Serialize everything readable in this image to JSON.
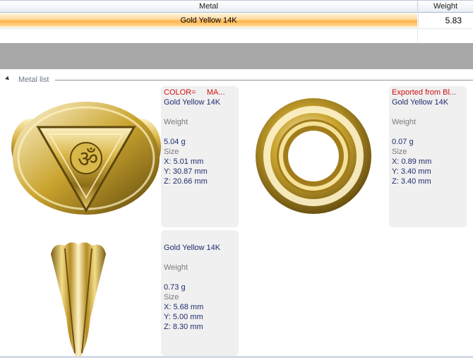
{
  "table": {
    "headers": {
      "metal": "Metal",
      "weight": "Weight"
    },
    "rows": [
      {
        "metal": "Gold Yellow 14K",
        "weight": "5.83"
      }
    ]
  },
  "group": {
    "label": "Metal list"
  },
  "items": [
    {
      "color_label": "COLOR=",
      "color_value": "MA...",
      "metal": "Gold Yellow 14K",
      "weight_label": "Weight",
      "weight": "5.04 g",
      "size_label": "Size",
      "x": "X: 5.01 mm",
      "y": "Y: 30.87 mm",
      "z": "Z: 20.66 mm"
    },
    {
      "header": "Exported from Bl...",
      "metal": "Gold Yellow 14K",
      "weight_label": "Weight",
      "weight": "0.07 g",
      "size_label": "Size",
      "x": "X: 0.89 mm",
      "y": "Y: 3.40 mm",
      "z": "Z: 3.40 mm"
    },
    {
      "metal": "Gold Yellow 14K",
      "weight_label": "Weight",
      "weight": "0.73 g",
      "size_label": "Size",
      "x": "X: 5.68 mm",
      "y": "Y: 5.00 mm",
      "z": "Z: 8.30 mm"
    }
  ],
  "colors": {
    "gold_light": "#f6e7a8",
    "gold_mid": "#c9a32e",
    "gold_dark": "#6b5210",
    "selected_row": "#ffb34a"
  }
}
